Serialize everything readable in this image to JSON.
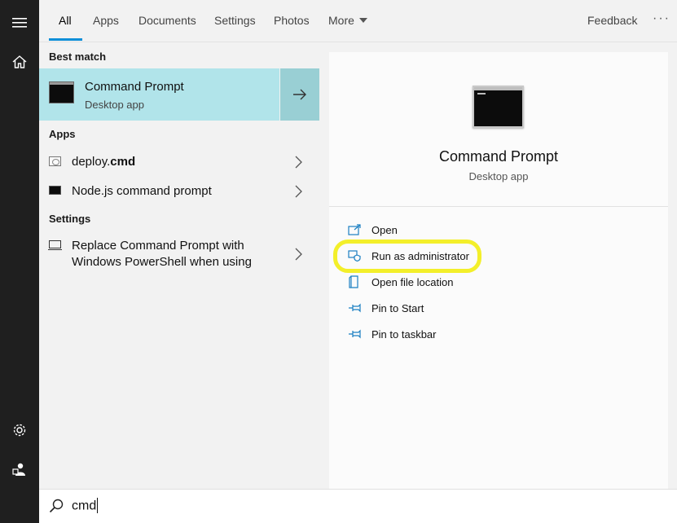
{
  "tabs": [
    {
      "label": "All",
      "active": true
    },
    {
      "label": "Apps"
    },
    {
      "label": "Documents"
    },
    {
      "label": "Settings"
    },
    {
      "label": "Photos"
    },
    {
      "label": "More"
    }
  ],
  "feedback_label": "Feedback",
  "more_options_label": "···",
  "rail_icons": [
    "hamburger-menu-icon",
    "home-icon",
    "settings-gear-icon",
    "user-account-icon"
  ],
  "results": {
    "best_match_heading": "Best match",
    "best_match": {
      "title": "Command Prompt",
      "subtitle": "Desktop app",
      "icon": "command-prompt-icon"
    },
    "apps_heading": "Apps",
    "apps": [
      {
        "name_prefix": "deploy.",
        "name_match": "cmd",
        "icon": "config-file-icon"
      },
      {
        "name": "Node.js command prompt",
        "icon": "command-prompt-icon"
      }
    ],
    "settings_heading": "Settings",
    "settings": [
      {
        "line1": "Replace Command Prompt with",
        "line2": "Windows PowerShell when using",
        "icon": "display-icon"
      }
    ]
  },
  "detail": {
    "title": "Command Prompt",
    "subtitle": "Desktop app",
    "actions": [
      {
        "label": "Open",
        "icon": "open-icon"
      },
      {
        "label": "Run as administrator",
        "icon": "shield-admin-icon",
        "highlighted": true
      },
      {
        "label": "Open file location",
        "icon": "file-location-icon"
      },
      {
        "label": "Pin to Start",
        "icon": "pin-icon"
      },
      {
        "label": "Pin to taskbar",
        "icon": "pin-icon"
      }
    ]
  },
  "search": {
    "value": "cmd"
  },
  "colors": {
    "accent_underline": "#0e8fd8",
    "best_match_bg": "#b1e4ea",
    "highlight_marker": "#f3ef2a",
    "rail_bg": "#1f1f1f",
    "action_icon": "#1a7fc2"
  }
}
